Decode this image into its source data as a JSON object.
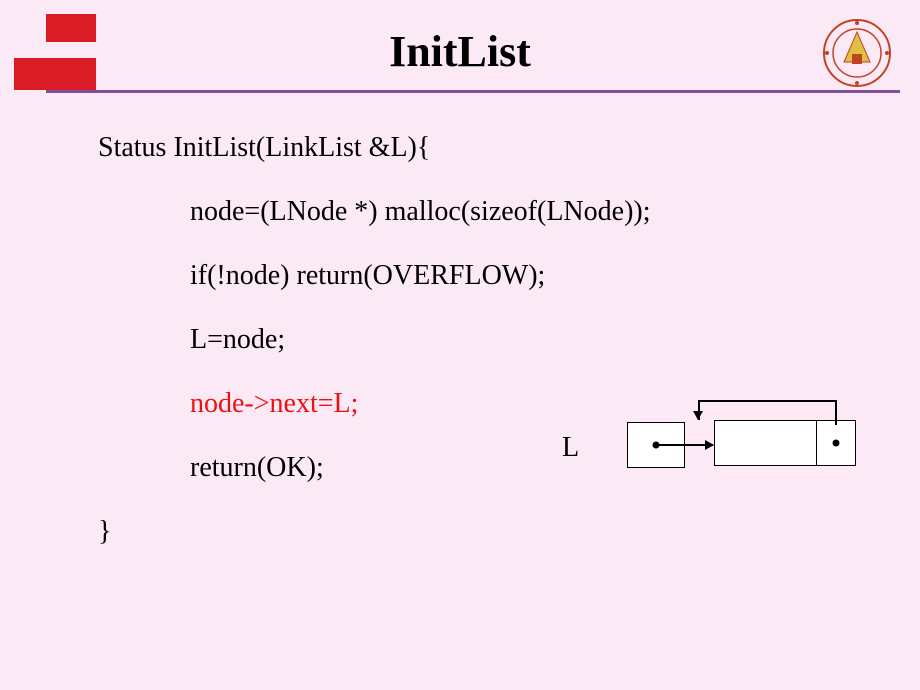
{
  "title": "InitList",
  "code": {
    "line1": "Status InitList(LinkList &L){",
    "line2": "node=(LNode *) malloc(sizeof(LNode));",
    "line3": "if(!node) return(OVERFLOW);",
    "line4": "L=node;",
    "line5": "node->next=L;",
    "line6": "return(OK);",
    "line7": "}"
  },
  "highlighted_line_index": 5,
  "diagram": {
    "label": "L"
  }
}
